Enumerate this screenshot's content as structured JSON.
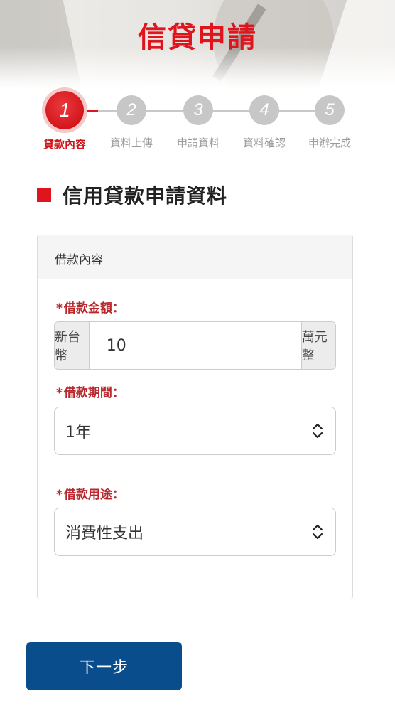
{
  "header": {
    "title": "信貸申請"
  },
  "steps": [
    {
      "number": "1",
      "label": "貸款內容",
      "active": true
    },
    {
      "number": "2",
      "label": "資料上傳",
      "active": false
    },
    {
      "number": "3",
      "label": "申請資料",
      "active": false
    },
    {
      "number": "4",
      "label": "資料確認",
      "active": false
    },
    {
      "number": "5",
      "label": "申辦完成",
      "active": false
    }
  ],
  "section": {
    "title": "信用貸款申請資料"
  },
  "card": {
    "header": "借款內容",
    "amount": {
      "required_mark": "*",
      "label": "借款金額：",
      "prefix": "新台幣",
      "value": "10",
      "suffix": "萬元整"
    },
    "period": {
      "required_mark": "*",
      "label": "借款期間：",
      "value": "1年"
    },
    "purpose": {
      "required_mark": "*",
      "label": "借款用途：",
      "value": "消費性支出"
    }
  },
  "actions": {
    "next_label": "下一步"
  },
  "colors": {
    "accent_red": "#e0141c",
    "label_red": "#b8282d",
    "button_blue": "#0a4d8c",
    "step_gray": "#c7c7c7"
  }
}
